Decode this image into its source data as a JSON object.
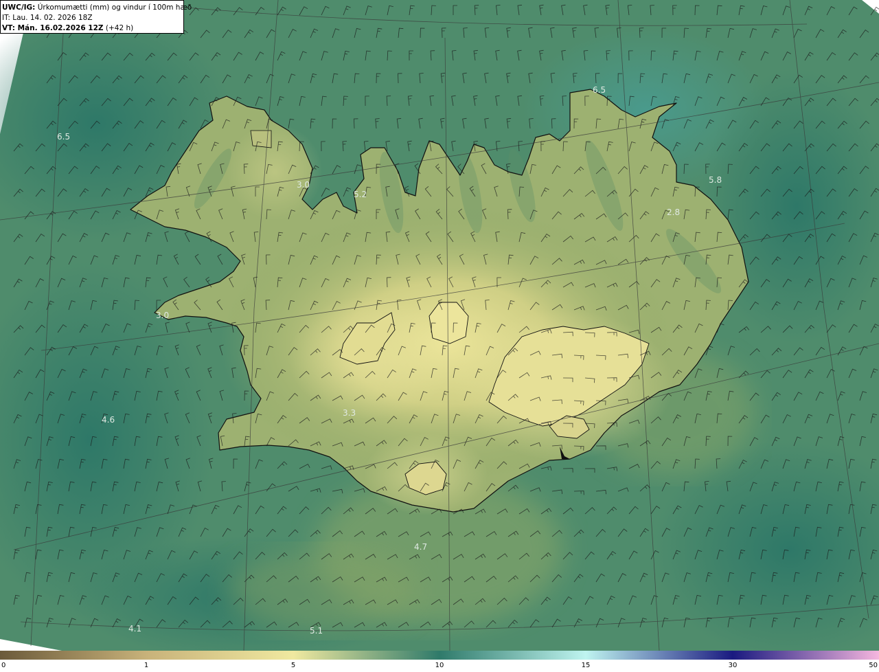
{
  "header": {
    "title_bold": "UWC/IG:",
    "title_rest": " Úrkomumætti (mm) og vindur í 100m hæð",
    "init_time": "IT: Lau. 14. 02. 2026 18Z",
    "valid_bold": "VT: Mán. 16.02.2026 12Z",
    "valid_rest": " (+42 h)"
  },
  "colors": {
    "ocean_dark": "#2f7a6a",
    "ocean_mid": "#4d8b6a",
    "land_mid": "#8fa968",
    "land_high": "#e6e195",
    "coast": "#101010",
    "barb": "#1a1a1a"
  },
  "value_labels": [
    {
      "id": "val-se-nw",
      "text": "6.5"
    },
    {
      "id": "val-ne",
      "text": "6.5"
    },
    {
      "id": "val-east",
      "text": "5.8"
    },
    {
      "id": "val-north",
      "text": "5.2"
    },
    {
      "id": "val-westfjords",
      "text": "3.0"
    },
    {
      "id": "val-east-2",
      "text": "2.8"
    },
    {
      "id": "val-west",
      "text": "3.0"
    },
    {
      "id": "val-south-west",
      "text": "4.6"
    },
    {
      "id": "val-center",
      "text": "3.3"
    },
    {
      "id": "val-south",
      "text": "4.7"
    },
    {
      "id": "val-sw-bottom",
      "text": "4.1"
    },
    {
      "id": "val-s-bottom",
      "text": "5.1"
    }
  ],
  "colorbar": {
    "ticks": [
      "0",
      "1",
      "5",
      "10",
      "15",
      "30",
      "50"
    ],
    "segments": [
      {
        "from": "#6b5a3a",
        "to": "#c8b27a"
      },
      {
        "from": "#c8b27a",
        "to": "#f0e9a0"
      },
      {
        "from": "#f0e9a0",
        "to": "#2f7a6a"
      },
      {
        "from": "#2f7a6a",
        "to": "#bff4f0"
      },
      {
        "from": "#bff4f0",
        "to": "#1a1a80"
      },
      {
        "from": "#1a1a80",
        "to": "#f5b6de"
      },
      {
        "from": "#f5b6de",
        "to": "#b0108a"
      }
    ]
  }
}
